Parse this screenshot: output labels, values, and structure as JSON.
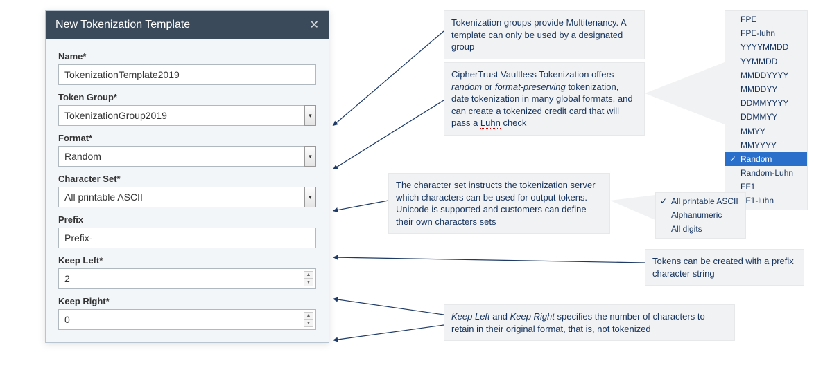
{
  "dialog": {
    "title": "New Tokenization Template",
    "fields": {
      "name": {
        "label": "Name*",
        "value": "TokenizationTemplate2019"
      },
      "tokenGroup": {
        "label": "Token Group*",
        "value": "TokenizationGroup2019"
      },
      "format": {
        "label": "Format*",
        "value": "Random"
      },
      "charSet": {
        "label": "Character Set*",
        "value": "All printable ASCII"
      },
      "prefix": {
        "label": "Prefix",
        "value": "Prefix-"
      },
      "keepLeft": {
        "label": "Keep Left*",
        "value": "2"
      },
      "keepRight": {
        "label": "Keep Right*",
        "value": "0"
      }
    }
  },
  "callouts": {
    "tokenGroup": "Tokenization groups provide Multitenancy. A template can only be used by a designated group",
    "format_pre": "CipherTrust Vaultless Tokenization offers ",
    "format_rand": "random",
    "format_or": " or ",
    "format_fp": "format-preserving",
    "format_mid": " tokenization, date tokenization in many global formats, and can create a tokenized credit card that will pass a ",
    "format_luhn": "Luhn",
    "format_post": " check",
    "charSet": "The character set instructs the tokenization server which characters can be used for output tokens. Unicode is supported and customers can define their own characters sets",
    "prefix": "Tokens can be created with a prefix character string",
    "keep_pre": "",
    "keep_kl": "Keep Left",
    "keep_and": " and ",
    "keep_kr": "Keep Right",
    "keep_post": " specifies the number of characters to retain in their original format, that is, not tokenized"
  },
  "formatOptions": [
    "FPE",
    "FPE-luhn",
    "YYYYMMDD",
    "YYMMDD",
    "MMDDYYYY",
    "MMDDYY",
    "DDMMYYYY",
    "DDMMYY",
    "MMYY",
    "MMYYYY",
    "Random",
    "Random-Luhn",
    "FF1",
    "FF1-luhn"
  ],
  "formatSelectedIndex": 10,
  "charsetOptions": [
    "All printable ASCII",
    "Alphanumeric",
    "All digits"
  ],
  "charsetSelectedIndex": 0
}
